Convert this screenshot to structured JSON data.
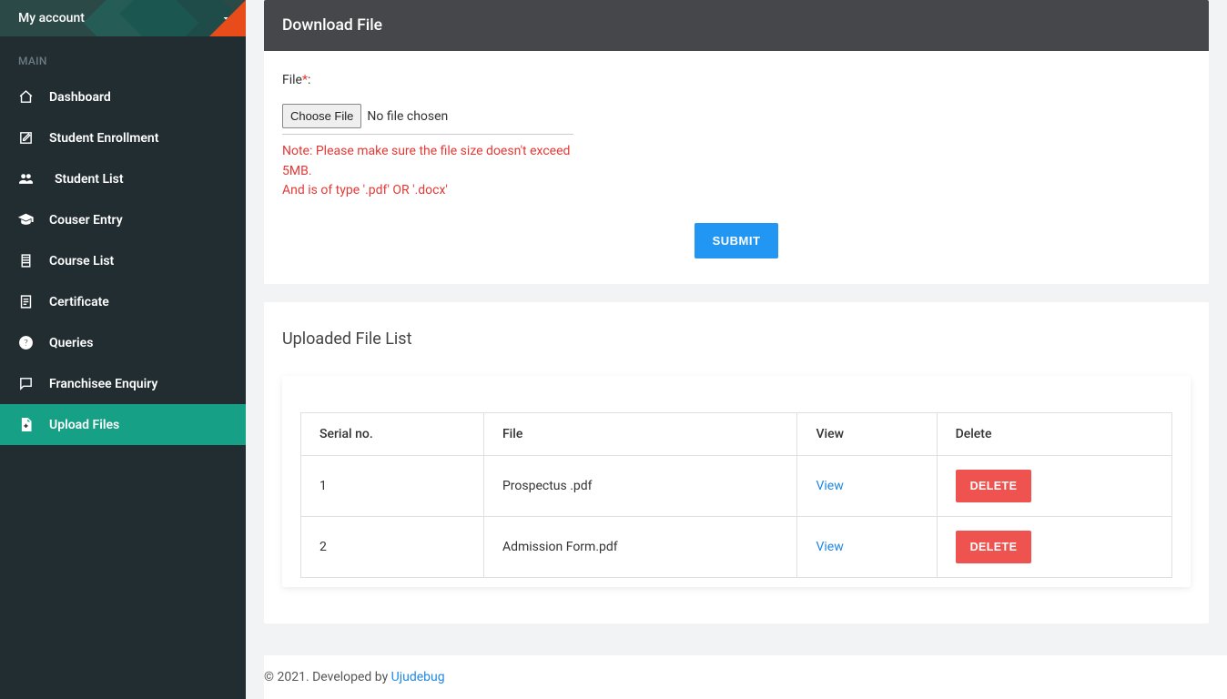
{
  "account": {
    "label": "My account"
  },
  "sidebar": {
    "section": "MAIN",
    "items": [
      {
        "label": "Dashboard",
        "icon": "home-icon"
      },
      {
        "label": "Student Enrollment",
        "icon": "edit-square-icon"
      },
      {
        "label": "Student List",
        "icon": "people-icon",
        "indent": true
      },
      {
        "label": "Couser Entry",
        "icon": "graduation-cap-icon"
      },
      {
        "label": "Course List",
        "icon": "clipboard-icon"
      },
      {
        "label": "Certificate",
        "icon": "document-icon"
      },
      {
        "label": "Queries",
        "icon": "question-circle-icon"
      },
      {
        "label": "Franchisee Enquiry",
        "icon": "chat-icon"
      },
      {
        "label": "Upload Files",
        "icon": "file-plus-icon",
        "active": true
      }
    ]
  },
  "download_card": {
    "title": "Download File",
    "file_label": "File",
    "required_mark": "*",
    "colon": ":",
    "choose_button": "Choose File",
    "no_file_text": "No file chosen",
    "note_line1": "Note: Please make sure the file size doesn't exceed 5MB.",
    "note_line2": "And is of type '.pdf' OR '.docx'",
    "submit_label": "SUBMIT"
  },
  "uploaded": {
    "title": "Uploaded File List",
    "headers": {
      "serial": "Serial no.",
      "file": "File",
      "view": "View",
      "delete": "Delete"
    },
    "view_label": "View",
    "delete_label": "DELETE",
    "rows": [
      {
        "serial": "1",
        "file": "Prospectus .pdf"
      },
      {
        "serial": "2",
        "file": "Admission Form.pdf"
      }
    ]
  },
  "footer": {
    "prefix": "© 2021. Developed by ",
    "link": "Ujudebug"
  }
}
